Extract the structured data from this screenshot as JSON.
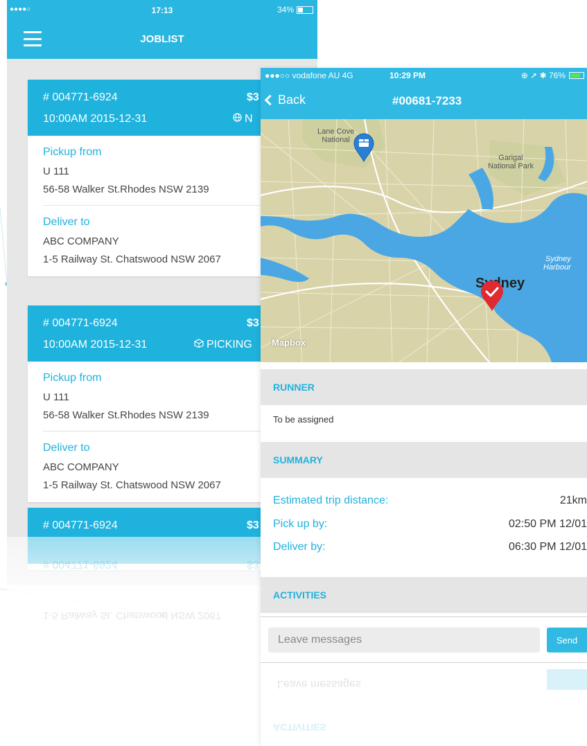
{
  "joblist": {
    "status": {
      "signal": "●●●●○",
      "time": "17:13",
      "battery": "34%",
      "battery_level": 0.34
    },
    "title": "JOBLIST",
    "menu_icon": "hamburger-menu-icon",
    "cards": [
      {
        "id": "# 004771-6924",
        "price": "$3",
        "time": "10:00AM 2015-12-31",
        "status_icon": "globe-icon",
        "status": "N",
        "pickup_label": "Pickup from",
        "pickup_line1": "U 111",
        "pickup_line2": "56-58 Walker St.Rhodes NSW 2139",
        "deliver_label": "Deliver to",
        "deliver_line1": "ABC COMPANY",
        "deliver_line2": "1-5 Railway St. Chatswood NSW 2067"
      },
      {
        "id": "# 004771-6924",
        "price": "$3",
        "time": "10:00AM 2015-12-31",
        "status_icon": "box-icon",
        "status": "PICKING",
        "pickup_label": "Pickup from",
        "pickup_line1": "U 111",
        "pickup_line2": "56-58 Walker St.Rhodes NSW 2139",
        "deliver_label": "Deliver to",
        "deliver_line1": "ABC COMPANY",
        "deliver_line2": "1-5 Railway St. Chatswood NSW 2067"
      },
      {
        "id": "# 004771-6924",
        "price": "$3"
      }
    ],
    "reflection": {
      "id": "# 004771-6924",
      "price": "$3",
      "address": "1-5 Railway St. Chatswood NSW 2067"
    }
  },
  "detail": {
    "status": {
      "carrier": "●●●○○ vodafone AU  4G",
      "time": "10:29 PM",
      "right": "⊕ ➚ ✱ 76%",
      "battery_level": 0.76
    },
    "back_label": "Back",
    "title": "#00681-7233",
    "map": {
      "labels": {
        "lane_cove": "Lane Cove\nNational",
        "garigal": "Garigal\nNational Park",
        "city": "Sydney",
        "harbour": "Sydney\nHarbour",
        "attribution": "Mapbox"
      },
      "pickup_pin_icon": "package-pin-icon",
      "dropoff_pin_icon": "check-pin-icon"
    },
    "runner_heading": "RUNNER",
    "runner_value": "To be assigned",
    "summary_heading": "SUMMARY",
    "summary": [
      {
        "label": "Estimated trip distance:",
        "value": "21km"
      },
      {
        "label": "Pick up by:",
        "value": "02:50 PM 12/01"
      },
      {
        "label": "Deliver by:",
        "value": "06:30 PM 12/01"
      }
    ],
    "activities_heading": "ACTIVITIES",
    "message_placeholder": "Leave messages",
    "send_label": "Send"
  },
  "colors": {
    "primary": "#29b6e0",
    "header_text": "#ffffff",
    "accent_text": "#1fb2dd",
    "pin_red": "#e02a32",
    "pin_blue": "#2a7fd4"
  }
}
